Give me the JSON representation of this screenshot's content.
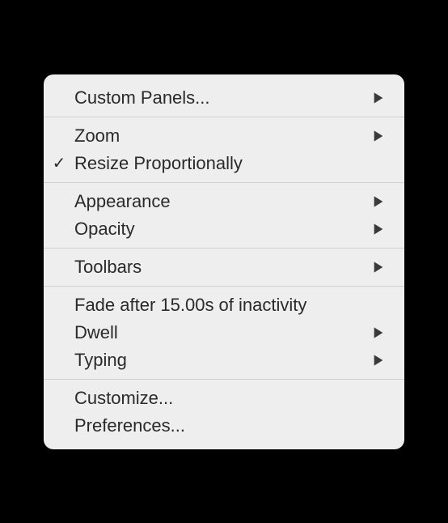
{
  "menu": {
    "groups": [
      {
        "items": [
          {
            "id": "custom-panels",
            "label": "Custom Panels...",
            "checked": false,
            "submenu": true
          }
        ]
      },
      {
        "items": [
          {
            "id": "zoom",
            "label": "Zoom",
            "checked": false,
            "submenu": true
          },
          {
            "id": "resize-proportionally",
            "label": "Resize Proportionally",
            "checked": true,
            "submenu": false
          }
        ]
      },
      {
        "items": [
          {
            "id": "appearance",
            "label": "Appearance",
            "checked": false,
            "submenu": true
          },
          {
            "id": "opacity",
            "label": "Opacity",
            "checked": false,
            "submenu": true
          }
        ]
      },
      {
        "items": [
          {
            "id": "toolbars",
            "label": "Toolbars",
            "checked": false,
            "submenu": true
          }
        ]
      },
      {
        "items": [
          {
            "id": "fade-after",
            "label": "Fade after 15.00s of inactivity",
            "checked": false,
            "submenu": false
          },
          {
            "id": "dwell",
            "label": "Dwell",
            "checked": false,
            "submenu": true
          },
          {
            "id": "typing",
            "label": "Typing",
            "checked": false,
            "submenu": true
          }
        ]
      },
      {
        "items": [
          {
            "id": "customize",
            "label": "Customize...",
            "checked": false,
            "submenu": false
          },
          {
            "id": "preferences",
            "label": "Preferences...",
            "checked": false,
            "submenu": false
          }
        ]
      }
    ]
  },
  "glyphs": {
    "check": "✓"
  }
}
